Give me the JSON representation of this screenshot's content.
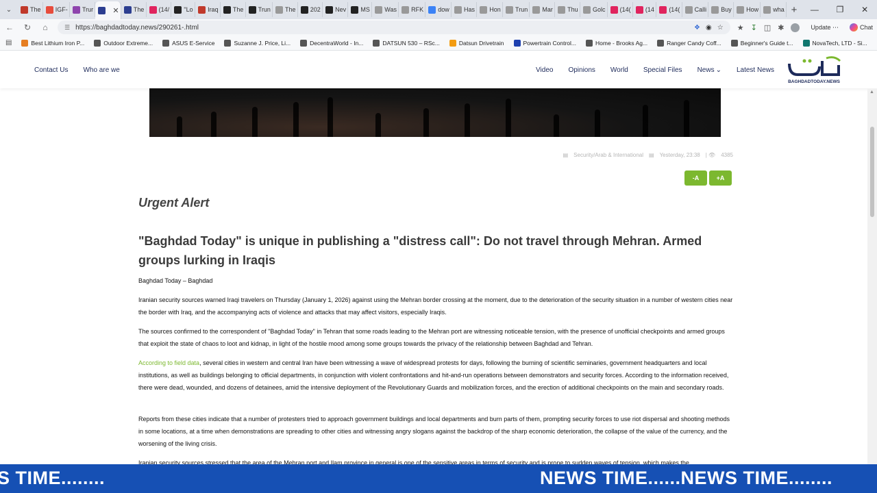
{
  "browser": {
    "tabs": [
      {
        "label": "The",
        "color": "#c0392b"
      },
      {
        "label": "IGF-",
        "color": "#e74c3c"
      },
      {
        "label": "Trur",
        "color": "#8e44ad"
      },
      {
        "label": "",
        "color": "#2c3e90",
        "active": true
      },
      {
        "label": "The",
        "color": "#2c3e90"
      },
      {
        "label": "(14/",
        "color": "#e0245e"
      },
      {
        "label": "\"Lo",
        "color": "#222"
      },
      {
        "label": "Iraq",
        "color": "#c0392b"
      },
      {
        "label": "The",
        "color": "#222"
      },
      {
        "label": "Trun",
        "color": "#222"
      },
      {
        "label": "The",
        "color": "#999"
      },
      {
        "label": "202",
        "color": "#222"
      },
      {
        "label": "Nev",
        "color": "#222"
      },
      {
        "label": "MS",
        "color": "#222"
      },
      {
        "label": "Was",
        "color": "#999"
      },
      {
        "label": "RFK",
        "color": "#999"
      },
      {
        "label": "dow",
        "color": "#3b82f6"
      },
      {
        "label": "Has",
        "color": "#999"
      },
      {
        "label": "Hon",
        "color": "#999"
      },
      {
        "label": "Trun",
        "color": "#999"
      },
      {
        "label": "Mar",
        "color": "#999"
      },
      {
        "label": "Thu",
        "color": "#999"
      },
      {
        "label": "Golc",
        "color": "#999"
      },
      {
        "label": "(14(",
        "color": "#e0245e"
      },
      {
        "label": "(14",
        "color": "#e0245e"
      },
      {
        "label": "(14(",
        "color": "#e0245e"
      },
      {
        "label": "Calli",
        "color": "#999"
      },
      {
        "label": "Buy",
        "color": "#999"
      },
      {
        "label": "How",
        "color": "#999"
      },
      {
        "label": "wha",
        "color": "#999"
      }
    ],
    "url": "https://baghdadtoday.news/290261-.html",
    "update_label": "Update",
    "chat_label": "Chat",
    "bookmarks": [
      {
        "label": "Best Lithium Iron P...",
        "color": "#e67e22"
      },
      {
        "label": "Outdoor Extreme...",
        "color": "#555"
      },
      {
        "label": "ASUS E-Service",
        "color": "#555"
      },
      {
        "label": "Suzanne J. Price, Li...",
        "color": "#555"
      },
      {
        "label": "DecentraWorld - In...",
        "color": "#555"
      },
      {
        "label": "DATSUN 530 – RSc...",
        "color": "#555"
      },
      {
        "label": "Datsun Drivetrain",
        "color": "#f39c12"
      },
      {
        "label": "Powertrain Control...",
        "color": "#1e40af"
      },
      {
        "label": "Home - Brooks Ag...",
        "color": "#555"
      },
      {
        "label": "Ranger Candy Coff...",
        "color": "#555"
      },
      {
        "label": "Beginner's Guide t...",
        "color": "#555"
      },
      {
        "label": "NovaTech, LTD - Si...",
        "color": "#0f766e"
      }
    ]
  },
  "site": {
    "nav_left": [
      "Contact Us",
      "Who are we"
    ],
    "nav_right": [
      "Video",
      "Opinions",
      "World",
      "Special Files",
      "News",
      "Latest News"
    ],
    "logo_text": "BAGHDADTODAY.NEWS",
    "brand_color": "#1d2a5a",
    "accent_color": "#7cb82f"
  },
  "article": {
    "meta_category": "Security/Arab & International",
    "meta_time": "Yesterday, 23:38",
    "meta_views": "4385",
    "font_decrease": "-A",
    "font_increase": "+A",
    "kicker": "Urgent Alert",
    "headline": "\"Baghdad Today\" is unique in publishing a \"distress call\": Do not travel through Mehran. Armed groups lurking in Iraqis",
    "dateline": "Baghdad Today – Baghdad",
    "p1": "Iranian security sources warned Iraqi travelers on Thursday (January 1, 2026) against using the Mehran border crossing at the moment, due to the deterioration of the security situation in a number of western cities near the border with Iraq, and the accompanying acts of violence and attacks that may affect visitors, especially Iraqis.",
    "p2": "The sources confirmed to the correspondent of \"Baghdad Today\" in Tehran that some roads leading to the Mehran port are witnessing noticeable tension, with the presence of unofficial checkpoints and armed groups that exploit the state of chaos to loot and kidnap, in light of the hostile mood among some groups towards the privacy of the relationship between Baghdad and Tehran.",
    "p3_link": "According to field data",
    "p3": ", several cities in western and central Iran have been witnessing a wave of widespread protests for days, following the burning of scientific seminaries, government headquarters and local institutions, as well as buildings belonging to official departments, in conjunction with violent confrontations and hit-and-run operations between demonstrators and security forces. According to the information received, there were dead, wounded, and dozens of detainees, amid the intensive deployment of the Revolutionary Guards and mobilization forces, and the erection of additional checkpoints on the main and secondary roads.",
    "p4": "Reports from these cities indicate that a number of protesters tried to approach government buildings and local departments and burn parts of them, prompting security forces to use riot dispersal and shooting methods in some locations, at a time when demonstrations are spreading to other cities and witnessing angry slogans against the backdrop of the sharp economic deterioration, the collapse of the value of the currency, and the worsening of the living crisis.",
    "p5": "Iranian security sources stressed that the area of the Mehran port and Ilam province in general is one of the sensitive areas in terms of security and is prone to sudden waves of tension, which makes the"
  },
  "ticker": {
    "left_text": "S TIME........",
    "right_text": "NEWS TIME......NEWS TIME........"
  }
}
